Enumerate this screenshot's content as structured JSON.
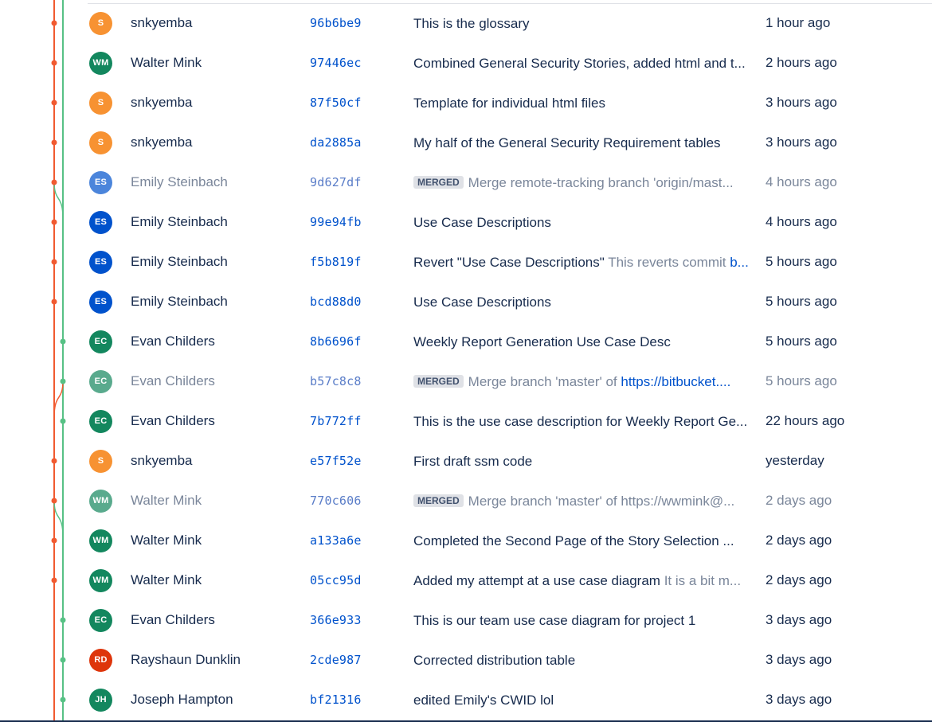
{
  "colors": {
    "branch_main": "#f15a30",
    "branch_secondary": "#57c185",
    "avatar_orange": "#f79232",
    "avatar_green": "#13875e",
    "avatar_blue": "#0052cc",
    "avatar_red": "#de350b"
  },
  "merge_label": "MERGED",
  "commits": [
    {
      "initials": "S",
      "author": "snkyemba",
      "hash": "96b6be9",
      "subject": "This is the glossary",
      "time": "1 hour ago",
      "avatar_color": "#f79232",
      "merge": false,
      "lane": 0
    },
    {
      "initials": "WM",
      "author": "Walter Mink",
      "hash": "97446ec",
      "subject": "Combined General Security Stories, added html and t...",
      "time": "2 hours ago",
      "avatar_color": "#13875e",
      "merge": false,
      "lane": 0
    },
    {
      "initials": "S",
      "author": "snkyemba",
      "hash": "87f50cf",
      "subject": "Template for individual html files",
      "time": "3 hours ago",
      "avatar_color": "#f79232",
      "merge": false,
      "lane": 0
    },
    {
      "initials": "S",
      "author": "snkyemba",
      "hash": "da2885a",
      "subject": "My half of the General Security Requirement tables",
      "time": "3 hours ago",
      "avatar_color": "#f79232",
      "merge": false,
      "lane": 0
    },
    {
      "initials": "ES",
      "author": "Emily Steinbach",
      "hash": "9d627df",
      "subject": "Merge remote-tracking branch 'origin/mast...",
      "time": "4 hours ago",
      "avatar_color": "#0052cc",
      "merge": true,
      "lane": 0
    },
    {
      "initials": "ES",
      "author": "Emily Steinbach",
      "hash": "99e94fb",
      "subject": "Use Case Descriptions",
      "time": "4 hours ago",
      "avatar_color": "#0052cc",
      "merge": false,
      "lane": 0
    },
    {
      "initials": "ES",
      "author": "Emily Steinbach",
      "hash": "f5b819f",
      "subject": "Revert \"Use Case Descriptions\"",
      "body": "This reverts commit",
      "body_link": "b...",
      "time": "5 hours ago",
      "avatar_color": "#0052cc",
      "merge": false,
      "lane": 0
    },
    {
      "initials": "ES",
      "author": "Emily Steinbach",
      "hash": "bcd88d0",
      "subject": "Use Case Descriptions",
      "time": "5 hours ago",
      "avatar_color": "#0052cc",
      "merge": false,
      "lane": 0
    },
    {
      "initials": "EC",
      "author": "Evan Childers",
      "hash": "8b6696f",
      "subject": "Weekly Report Generation Use Case Desc",
      "time": "5 hours ago",
      "avatar_color": "#13875e",
      "merge": false,
      "lane": 1
    },
    {
      "initials": "EC",
      "author": "Evan Childers",
      "hash": "b57c8c8",
      "subject": "Merge branch 'master' of",
      "body_link": "https://bitbucket....",
      "time": "5 hours ago",
      "avatar_color": "#13875e",
      "merge": true,
      "lane": 1
    },
    {
      "initials": "EC",
      "author": "Evan Childers",
      "hash": "7b772ff",
      "subject": "This is the use case description for Weekly Report Ge...",
      "time": "22 hours ago",
      "avatar_color": "#13875e",
      "merge": false,
      "lane": 1
    },
    {
      "initials": "S",
      "author": "snkyemba",
      "hash": "e57f52e",
      "subject": "First draft ssm code",
      "time": "yesterday",
      "avatar_color": "#f79232",
      "merge": false,
      "lane": 0
    },
    {
      "initials": "WM",
      "author": "Walter Mink",
      "hash": "770c606",
      "subject": "Merge branch 'master' of https://wwmink@...",
      "time": "2 days ago",
      "avatar_color": "#13875e",
      "merge": true,
      "lane": 0
    },
    {
      "initials": "WM",
      "author": "Walter Mink",
      "hash": "a133a6e",
      "subject": "Completed the Second Page of the Story Selection ...",
      "time": "2 days ago",
      "avatar_color": "#13875e",
      "merge": false,
      "lane": 0
    },
    {
      "initials": "WM",
      "author": "Walter Mink",
      "hash": "05cc95d",
      "subject": "Added my attempt at a use case diagram",
      "body": "It is a bit m...",
      "time": "2 days ago",
      "avatar_color": "#13875e",
      "merge": false,
      "lane": 0
    },
    {
      "initials": "EC",
      "author": "Evan Childers",
      "hash": "366e933",
      "subject": "This is our team use case diagram for project 1",
      "time": "3 days ago",
      "avatar_color": "#13875e",
      "merge": false,
      "lane": 1
    },
    {
      "initials": "RD",
      "author": "Rayshaun Dunklin",
      "hash": "2cde987",
      "subject": "Corrected distribution table",
      "time": "3 days ago",
      "avatar_color": "#de350b",
      "merge": false,
      "lane": 1
    },
    {
      "initials": "JH",
      "author": "Joseph Hampton",
      "hash": "bf21316",
      "subject": "edited Emily's CWID lol",
      "time": "3 days ago",
      "avatar_color": "#13875e",
      "merge": false,
      "lane": 1
    }
  ]
}
